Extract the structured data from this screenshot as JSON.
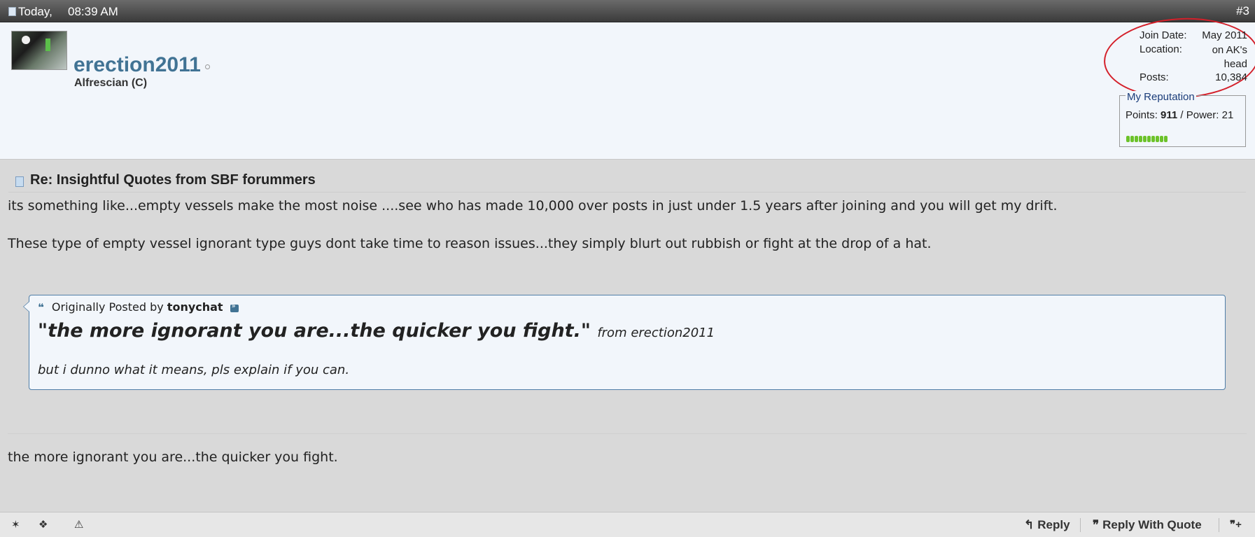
{
  "header": {
    "date": "Today,",
    "time": "08:39 AM",
    "post_number": "#3"
  },
  "user": {
    "username": "erection2011",
    "title": "Alfrescian (C)",
    "join_date_label": "Join Date:",
    "join_date": "May 2011",
    "location_label": "Location:",
    "location": "on AK's head",
    "posts_label": "Posts:",
    "posts": "10,384",
    "reputation": {
      "legend": "My Reputation",
      "points_label": "Points:",
      "points": "911",
      "sep": "/",
      "power_label": "Power:",
      "power": "21",
      "bar_count": 10
    }
  },
  "post": {
    "title": "Re: Insightful Quotes from SBF forummers",
    "para1": "its something like...empty vessels make the most noise ....see who has made 10,000 over posts in just under 1.5 years after joining and you will get my drift.",
    "para2": "These type of empty vessel ignorant type guys dont take time to reason issues...they simply blurt out rubbish or fight at the drop of a hat.",
    "quote": {
      "prefix": "Originally Posted by",
      "author": "tonychat",
      "big_text": "\"the more ignorant you are...the quicker you fight.\"",
      "from_text": "from erection2011",
      "sub_text": "but i dunno what it means, pls explain if you can."
    },
    "para3": "the more ignorant you are...the quicker you fight."
  },
  "footer": {
    "reply_label": "Reply",
    "reply_quote_label": "Reply With Quote"
  },
  "colors": {
    "username": "#417394",
    "annotation_circle": "#d4202a",
    "rep_bar": "#6cc22a",
    "quote_border": "#4f7ea8"
  }
}
